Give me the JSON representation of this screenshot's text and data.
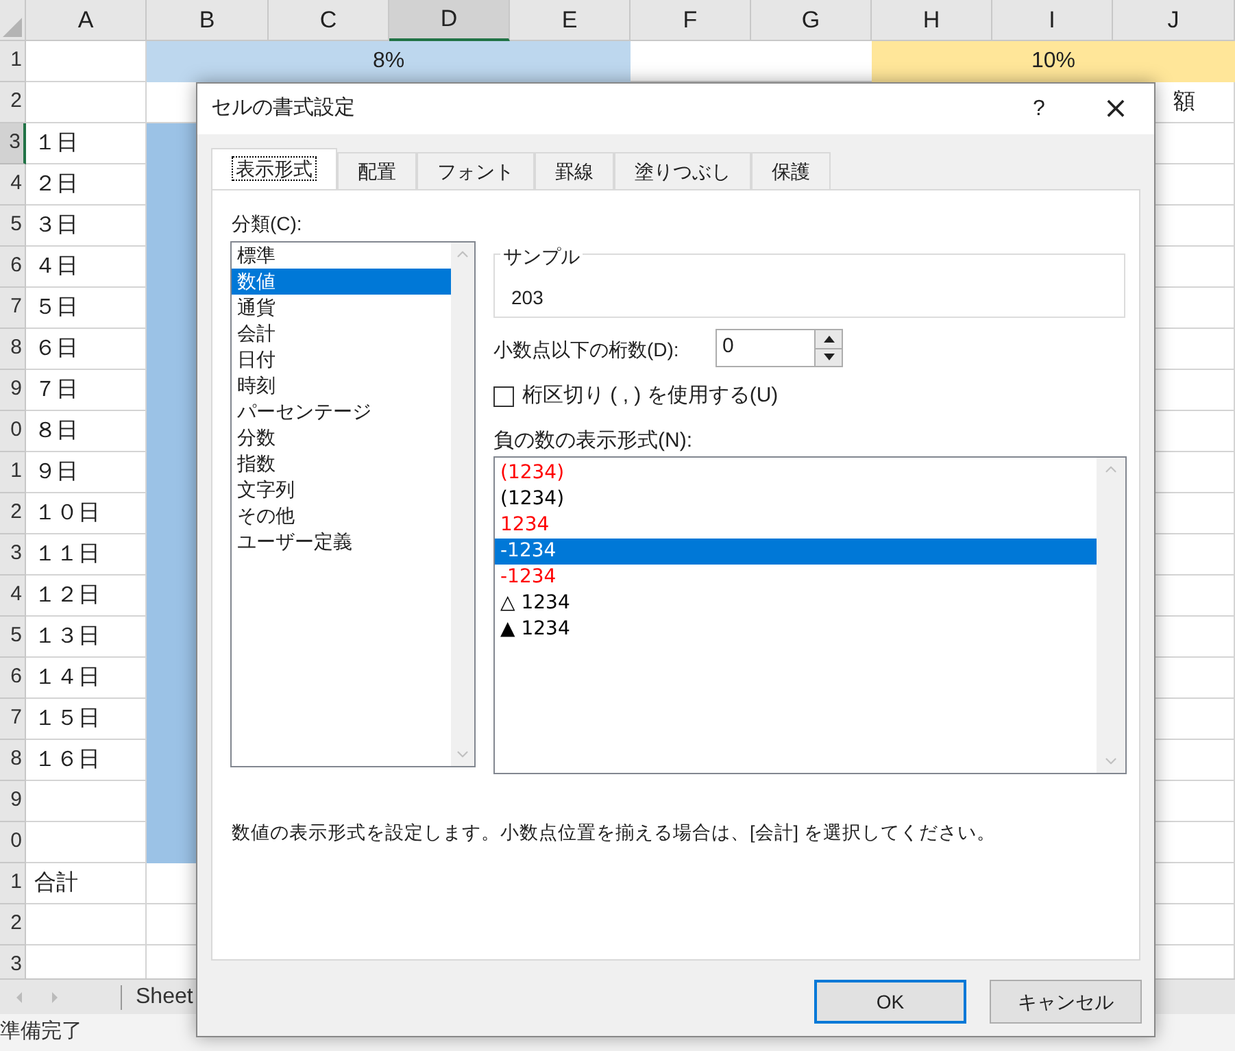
{
  "sheet": {
    "columns": [
      {
        "label": "A",
        "selected": false
      },
      {
        "label": "B",
        "selected": false
      },
      {
        "label": "C",
        "selected": false
      },
      {
        "label": "D",
        "selected": true
      },
      {
        "label": "E",
        "selected": false
      },
      {
        "label": "F",
        "selected": false
      },
      {
        "label": "G",
        "selected": false
      },
      {
        "label": "H",
        "selected": false
      },
      {
        "label": "I",
        "selected": false
      },
      {
        "label": "J",
        "selected": false
      }
    ],
    "rows": [
      {
        "kind": "rates",
        "header": "1",
        "selected": false,
        "rates": [
          {
            "text": "8%",
            "color": "#bdd7ee"
          },
          {
            "text": "10%",
            "color": "#ffe699"
          }
        ]
      },
      {
        "kind": "normal",
        "header": "2",
        "selected": false,
        "b_filled": false,
        "j": "額"
      },
      {
        "kind": "normal",
        "header": "3",
        "selected": true,
        "a": "１日",
        "b_filled": true
      },
      {
        "kind": "normal",
        "header": "4",
        "selected": false,
        "a": "２日",
        "b_filled": true
      },
      {
        "kind": "normal",
        "header": "5",
        "selected": false,
        "a": "３日",
        "b_filled": true
      },
      {
        "kind": "normal",
        "header": "6",
        "selected": false,
        "a": "４日",
        "b_filled": true
      },
      {
        "kind": "normal",
        "header": "7",
        "selected": false,
        "a": "５日",
        "b_filled": true
      },
      {
        "kind": "normal",
        "header": "8",
        "selected": false,
        "a": "６日",
        "b_filled": true
      },
      {
        "kind": "normal",
        "header": "9",
        "selected": false,
        "a": "７日",
        "b_filled": true
      },
      {
        "kind": "normal",
        "header": "0",
        "selected": false,
        "a": "８日",
        "b_filled": true
      },
      {
        "kind": "normal",
        "header": "1",
        "selected": false,
        "a": "９日",
        "b_filled": true
      },
      {
        "kind": "normal",
        "header": "2",
        "selected": false,
        "a": "１０日",
        "b_filled": true
      },
      {
        "kind": "normal",
        "header": "3",
        "selected": false,
        "a": "１１日",
        "b_filled": true
      },
      {
        "kind": "normal",
        "header": "4",
        "selected": false,
        "a": "１２日",
        "b_filled": true
      },
      {
        "kind": "normal",
        "header": "5",
        "selected": false,
        "a": "１３日",
        "b_filled": true
      },
      {
        "kind": "normal",
        "header": "6",
        "selected": false,
        "a": "１４日",
        "b_filled": true
      },
      {
        "kind": "normal",
        "header": "7",
        "selected": false,
        "a": "１５日",
        "b_filled": true
      },
      {
        "kind": "normal",
        "header": "8",
        "selected": false,
        "a": "１６日",
        "b_filled": true
      },
      {
        "kind": "normal",
        "header": "9",
        "selected": false,
        "b_filled": true
      },
      {
        "kind": "normal",
        "header": "0",
        "selected": false,
        "b_filled": true
      },
      {
        "kind": "normal",
        "header": "1",
        "selected": false,
        "a": "合計",
        "b_filled": false
      },
      {
        "kind": "normal",
        "header": "2",
        "selected": false,
        "b_filled": false
      },
      {
        "kind": "normal",
        "header": "3",
        "selected": false,
        "b_filled": false
      }
    ],
    "sheet_tab": "Sheet",
    "status": "準備完了"
  },
  "dialog": {
    "title": "セルの書式設定",
    "help": "?",
    "close": "×",
    "tabs": [
      {
        "label": "表示形式",
        "selected": true
      },
      {
        "label": "配置",
        "selected": false
      },
      {
        "label": "フォント",
        "selected": false
      },
      {
        "label": "罫線",
        "selected": false
      },
      {
        "label": "塗りつぶし",
        "selected": false
      },
      {
        "label": "保護",
        "selected": false
      }
    ],
    "category_label": "分類(C):",
    "categories": [
      {
        "label": "標準",
        "selected": false
      },
      {
        "label": "数値",
        "selected": true
      },
      {
        "label": "通貨",
        "selected": false
      },
      {
        "label": "会計",
        "selected": false
      },
      {
        "label": "日付",
        "selected": false
      },
      {
        "label": "時刻",
        "selected": false
      },
      {
        "label": "パーセンテージ",
        "selected": false
      },
      {
        "label": "分数",
        "selected": false
      },
      {
        "label": "指数",
        "selected": false
      },
      {
        "label": "文字列",
        "selected": false
      },
      {
        "label": "その他",
        "selected": false
      },
      {
        "label": "ユーザー定義",
        "selected": false
      }
    ],
    "sample_label": "サンプル",
    "sample_value": "203",
    "decimals_label": "小数点以下の桁数(D):",
    "decimals_value": "0",
    "separator": {
      "label": "桁区切り ( , ) を使用する(U)",
      "checked": false
    },
    "negative_label": "負の数の表示形式(N):",
    "negative_formats": [
      {
        "text": "(1234)",
        "color": "#ff0000",
        "selected": false
      },
      {
        "text": "(1234)",
        "color": "#000000",
        "selected": false
      },
      {
        "text": "1234",
        "color": "#ff0000",
        "selected": false
      },
      {
        "text": "-1234",
        "color": "#ffffff",
        "selected": true
      },
      {
        "text": "-1234",
        "color": "#ff0000",
        "selected": false
      },
      {
        "text": "△ 1234",
        "color": "#000000",
        "selected": false
      },
      {
        "text": "▲ 1234",
        "color": "#000000",
        "selected": false
      }
    ],
    "description": "数値の表示形式を設定します。小数点位置を揃える場合は、[会計] を選択してください。",
    "buttons": [
      {
        "label": "OK",
        "kind": "primary"
      },
      {
        "label": "キャンセル",
        "kind": "secondary"
      }
    ]
  }
}
